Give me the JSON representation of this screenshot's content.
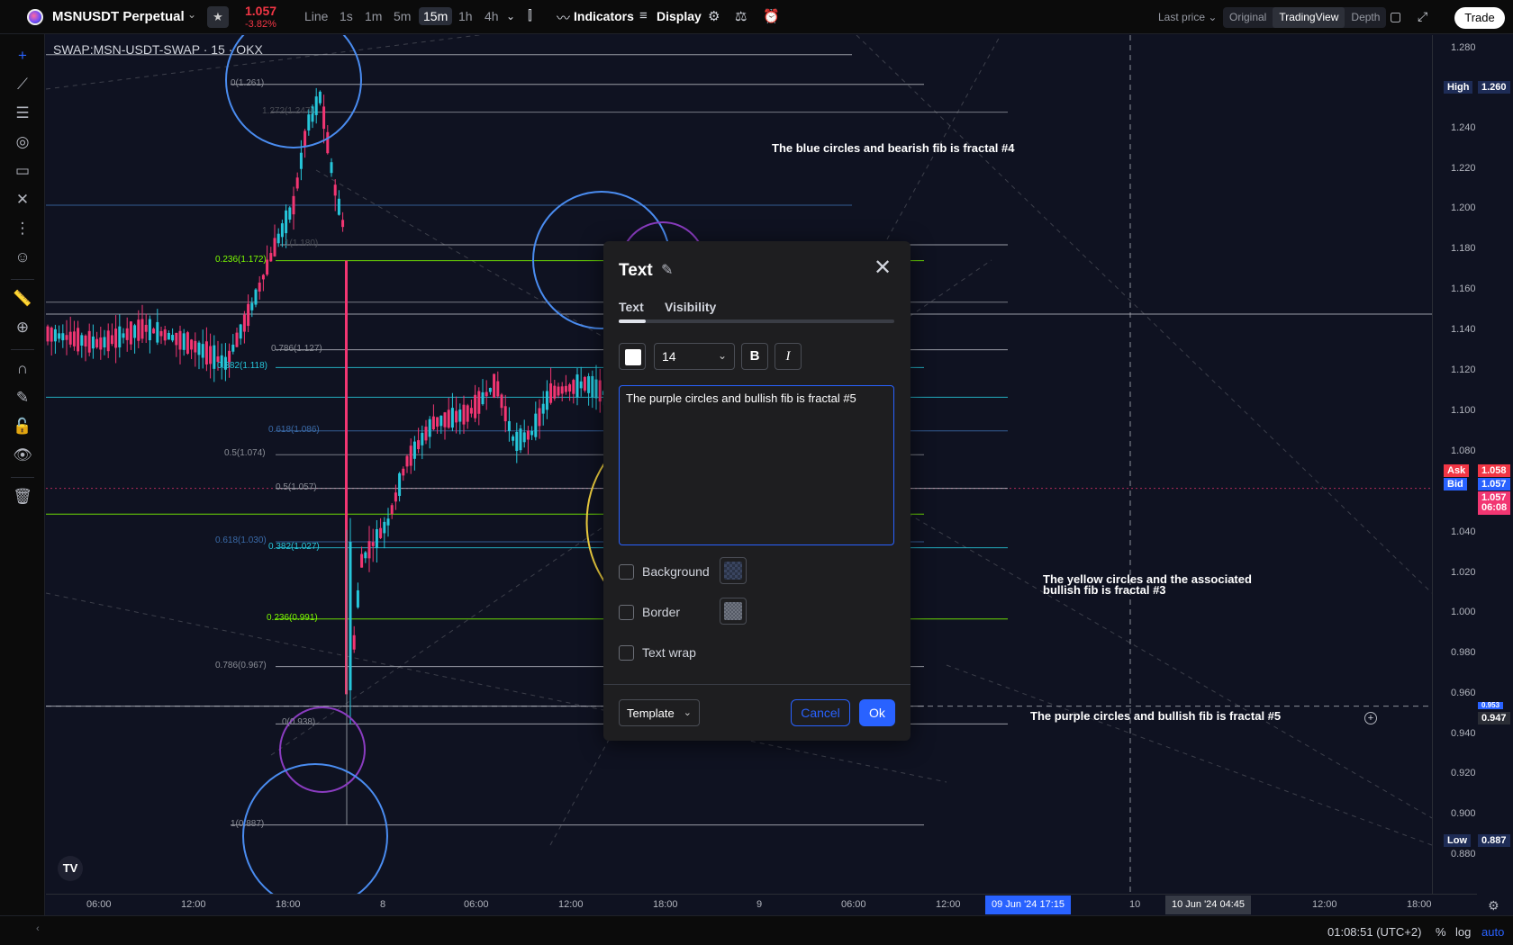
{
  "topbar": {
    "symbol": "MSNUSDT Perpetual",
    "last_price": "1.057",
    "change_pct": "-3.82%",
    "timeframes": [
      "Line",
      "1s",
      "1m",
      "5m",
      "15m",
      "1h",
      "4h"
    ],
    "active_timeframe": "15m",
    "indicators_label": "Indicators",
    "display_label": "Display",
    "last_price_select": "Last price",
    "views": [
      "Original",
      "TradingView",
      "Depth"
    ],
    "active_view": "TradingView",
    "trade_label": "Trade"
  },
  "chart": {
    "title": "SWAP:MSN-USDT-SWAP · 15 · OKX",
    "annotations": [
      "The blue circles and bearish fib is fractal #4",
      "The yellow circles and the associated\nbullish fib is fractal #3",
      "The purple circles and bullish fib is fractal #5"
    ],
    "fib_labels": [
      "0(1.261)",
      "1.272(1.247)",
      "0.236(1.172)",
      "1(1.180)",
      "0.786(1.127)",
      "0.382(1.118)",
      "0.618(1.086)",
      "0.5(1.074)",
      "0.5(1.057)",
      "0.618(1.030)",
      "0.382(1.027)",
      "0.236(0.991)",
      "0.786(0.967)",
      "0(0.938)",
      "1(0.887)"
    ],
    "colors": {
      "up": "#26c6da",
      "down": "#f23672",
      "blue_circle": "#4a8cf0",
      "purple_circle": "#8a3cc0",
      "yellow_circle": "#f0d040",
      "green_fib": "#7cfc00"
    }
  },
  "price_scale": {
    "ticks": [
      "1.280",
      "1.240",
      "1.220",
      "1.200",
      "1.180",
      "1.160",
      "1.140",
      "1.120",
      "1.100",
      "1.080",
      "1.040",
      "1.020",
      "1.000",
      "0.980",
      "0.960",
      "0.940",
      "0.920",
      "0.900",
      "0.880"
    ],
    "high_label": "High",
    "high_value": "1.260",
    "ask_label": "Ask",
    "ask_value": "1.058",
    "bid_label": "Bid",
    "bid_value": "1.057",
    "last_value": "1.057",
    "countdown": "06:08",
    "cursor_value": "0.947",
    "hidden_value": "0.953",
    "low_label": "Low",
    "low_value": "0.887"
  },
  "time_axis": {
    "ticks": [
      "06:00",
      "12:00",
      "18:00",
      "8",
      "06:00",
      "12:00",
      "18:00",
      "9",
      "06:00",
      "12:00",
      "10",
      "12:00",
      "18:00"
    ],
    "badge_1": "09 Jun '24   17:15",
    "badge_2": "10 Jun '24   04:45"
  },
  "status": {
    "clock": "01:08:51 (UTC+2)",
    "pct": "%",
    "log": "log",
    "auto": "auto"
  },
  "dialog": {
    "title": "Text",
    "tabs": [
      "Text",
      "Visibility"
    ],
    "font_size": "14",
    "bold": "B",
    "italic": "I",
    "text_value": "The purple circles and bullish fib is fractal #5",
    "background_label": "Background",
    "border_label": "Border",
    "text_wrap_label": "Text wrap",
    "template_label": "Template",
    "cancel_label": "Cancel",
    "ok_label": "Ok"
  }
}
